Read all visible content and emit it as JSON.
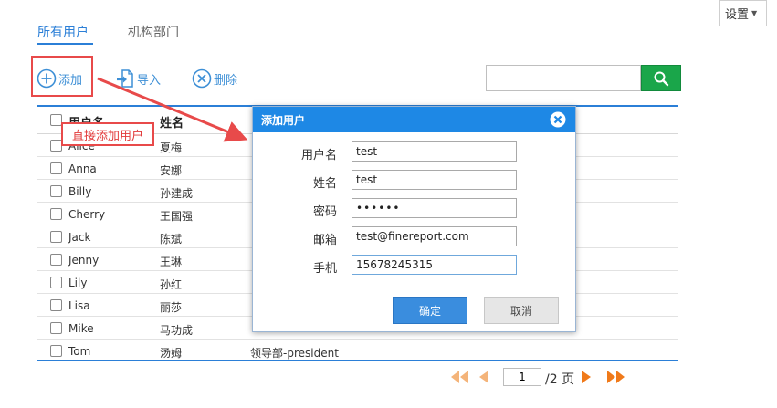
{
  "settings": {
    "label": "设置"
  },
  "tabs": [
    {
      "label": "所有用户",
      "active": true
    },
    {
      "label": "机构部门",
      "active": false
    }
  ],
  "toolbar": {
    "add_label": "添加",
    "import_label": "导入",
    "delete_label": "删除"
  },
  "search": {
    "value": "",
    "placeholder": ""
  },
  "table": {
    "headers": [
      "用户名",
      "姓名",
      ""
    ],
    "rows": [
      {
        "username": "Alice",
        "name": "夏梅",
        "dept": ""
      },
      {
        "username": "Anna",
        "name": "安娜",
        "dept": ""
      },
      {
        "username": "Billy",
        "name": "孙建成",
        "dept": ""
      },
      {
        "username": "Cherry",
        "name": "王国强",
        "dept": ""
      },
      {
        "username": "Jack",
        "name": "陈斌",
        "dept": ""
      },
      {
        "username": "Jenny",
        "name": "王琳",
        "dept": ""
      },
      {
        "username": "Lily",
        "name": "孙红",
        "dept": ""
      },
      {
        "username": "Lisa",
        "name": "丽莎",
        "dept": ""
      },
      {
        "username": "Mike",
        "name": "马功成",
        "dept": ""
      },
      {
        "username": "Tom",
        "name": "汤姆",
        "dept": "领导部-president"
      }
    ]
  },
  "callout": {
    "text": "直接添加用户"
  },
  "dialog": {
    "title": "添加用户",
    "fields": [
      {
        "label": "用户名",
        "value": "test"
      },
      {
        "label": "姓名",
        "value": "test"
      },
      {
        "label": "密码",
        "value": "••••••"
      },
      {
        "label": "邮箱",
        "value": "test@finereport.com"
      },
      {
        "label": "手机",
        "value": "15678245315"
      }
    ],
    "ok_label": "确定",
    "cancel_label": "取消"
  },
  "pagination": {
    "current": "1",
    "total_text": "/2 页"
  },
  "colors": {
    "accent": "#2b7fd7",
    "dialog_header": "#1e88e5",
    "search_button": "#1aa64a",
    "annotation_red": "#e84a4a",
    "pager_orange": "#f08a24"
  }
}
